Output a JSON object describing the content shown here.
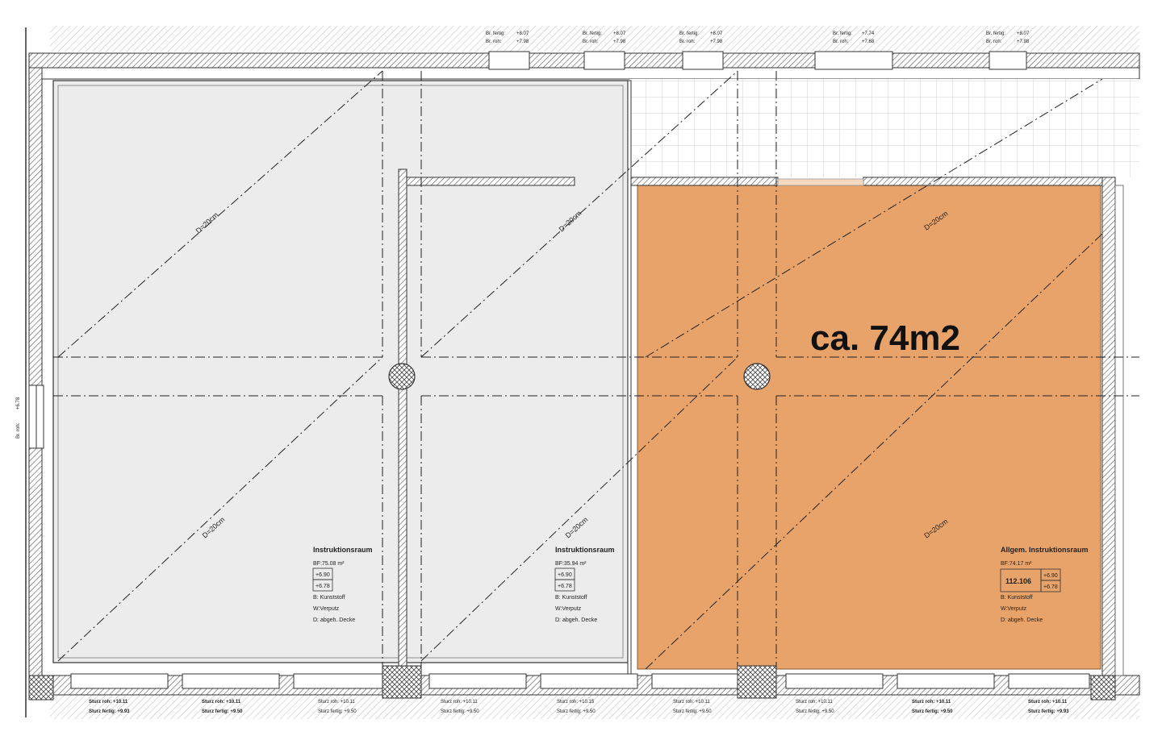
{
  "highlight": {
    "area_label": "ca. 74m2",
    "color": "#e8a36a"
  },
  "colors": {
    "wall_hatch": "#555555",
    "room_fill": "#ececec",
    "grid": "#d8d8d8",
    "outline": "#333333"
  },
  "diagonal_labels": [
    "D=20cm",
    "D=20cm",
    "D=20cm",
    "D=20cm",
    "D=20cm",
    "D=20cm"
  ],
  "top_windows": [
    {
      "fertig": "Br. fertig:",
      "fertig_val": "+8.07",
      "roh": "Br. roh:",
      "roh_val": "+7.98"
    },
    {
      "fertig": "Br. fertig:",
      "fertig_val": "+8.07",
      "roh": "Br. roh:",
      "roh_val": "+7.98"
    },
    {
      "fertig": "Br. fertig:",
      "fertig_val": "+8.07",
      "roh": "Br. roh:",
      "roh_val": "+7.98"
    },
    {
      "fertig": "Br. fertig:",
      "fertig_val": "+7.74",
      "roh": "Br. roh:",
      "roh_val": "+7.68"
    },
    {
      "fertig": "Br. fertig:",
      "fertig_val": "+8.07",
      "roh": "Br. roh:",
      "roh_val": "+7.98"
    }
  ],
  "left_window": {
    "roh": "Br. roh:",
    "val": "+6.78"
  },
  "bottom_lintels": [
    {
      "roh": "Sturz roh: +10.11",
      "fertig": "Sturz fertig: +9.93"
    },
    {
      "roh": "Sturz roh: +10.11",
      "fertig": "Sturz fertig: +9.50"
    },
    {
      "roh": "Sturz roh: +10.11",
      "fertig": "Sturz fertig: +9.50"
    },
    {
      "roh": "Sturz roh: +10.11",
      "fertig": "Sturz fertig: +9.50"
    },
    {
      "roh": "Sturz roh: +10.15",
      "fertig": "Sturz fertig: +9.50"
    },
    {
      "roh": "Sturz roh: +10.11",
      "fertig": "Sturz fertig: +9.50"
    },
    {
      "roh": "Sturz roh: +10.11",
      "fertig": "Sturz fertig: +9.50"
    },
    {
      "roh": "Sturz roh: +10.11",
      "fertig": "Sturz fertig: +9.50"
    },
    {
      "roh": "Sturz roh: +10.11",
      "fertig": "Sturz fertig: +9.93"
    }
  ],
  "rooms": [
    {
      "name": "Instruktionsraum",
      "area": "BF:75.08 m²",
      "level1": "+6.90",
      "level2": "+6.78",
      "floor": "B: Kunststoff",
      "wall": "W:Verputz",
      "ceiling": "D: abgeh. Decke"
    },
    {
      "name": "Instruktionsraum",
      "area": "BF:35.94 m²",
      "level1": "+6.90",
      "level2": "+6.78",
      "floor": "B: Kunststoff",
      "wall": "W:Verputz",
      "ceiling": "D: abgeh. Decke"
    },
    {
      "name": "Allgem. Instruktionsraum",
      "area": "BF:74.17 m²",
      "number": "112.106",
      "level1": "+6.90",
      "level2": "+6.78",
      "floor": "B: Kunststoff",
      "wall": "W:Verputz",
      "ceiling": "D: abgeh. Decke"
    }
  ]
}
